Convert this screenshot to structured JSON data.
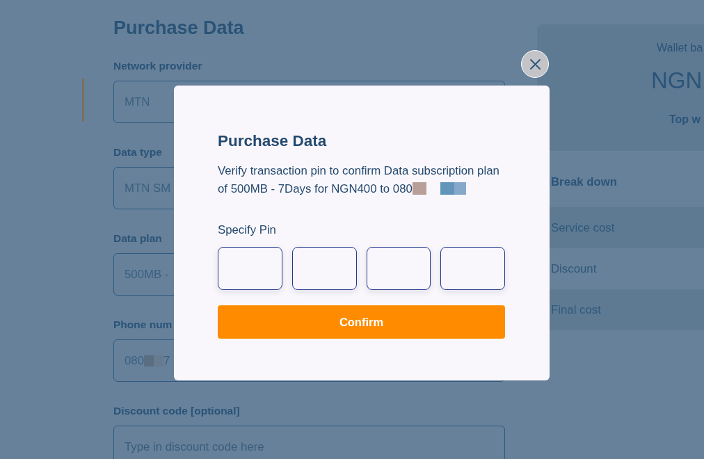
{
  "page": {
    "title": "Purchase Data"
  },
  "form": {
    "fields": [
      {
        "label": "Network provider",
        "value": "MTN"
      },
      {
        "label": "Data type",
        "value": "MTN SM"
      },
      {
        "label": "Data plan",
        "value": "500MB -"
      },
      {
        "label": "Phone num",
        "value": "080",
        "value_after_redaction": "7"
      },
      {
        "label": "Discount code [optional]",
        "placeholder": "Type in discount code here"
      }
    ]
  },
  "wallet": {
    "label": "Wallet ba",
    "balance": "NGN",
    "top_up": "Top w"
  },
  "breakdown": {
    "title": "Break down",
    "rows": [
      "Service cost",
      "Discount",
      "Final cost"
    ]
  },
  "modal": {
    "dismissible": true,
    "title": "Purchase Data",
    "message": "Verify transaction pin to confirm Data subscription plan of 500MB - 7Days for NGN400 to 080",
    "message_redacted": true,
    "pin_label": "Specify Pin",
    "pin_fields": [
      {
        "filled": false
      },
      {
        "filled": false
      },
      {
        "filled": false
      },
      {
        "filled": false
      }
    ],
    "confirm_button": "Confirm"
  }
}
